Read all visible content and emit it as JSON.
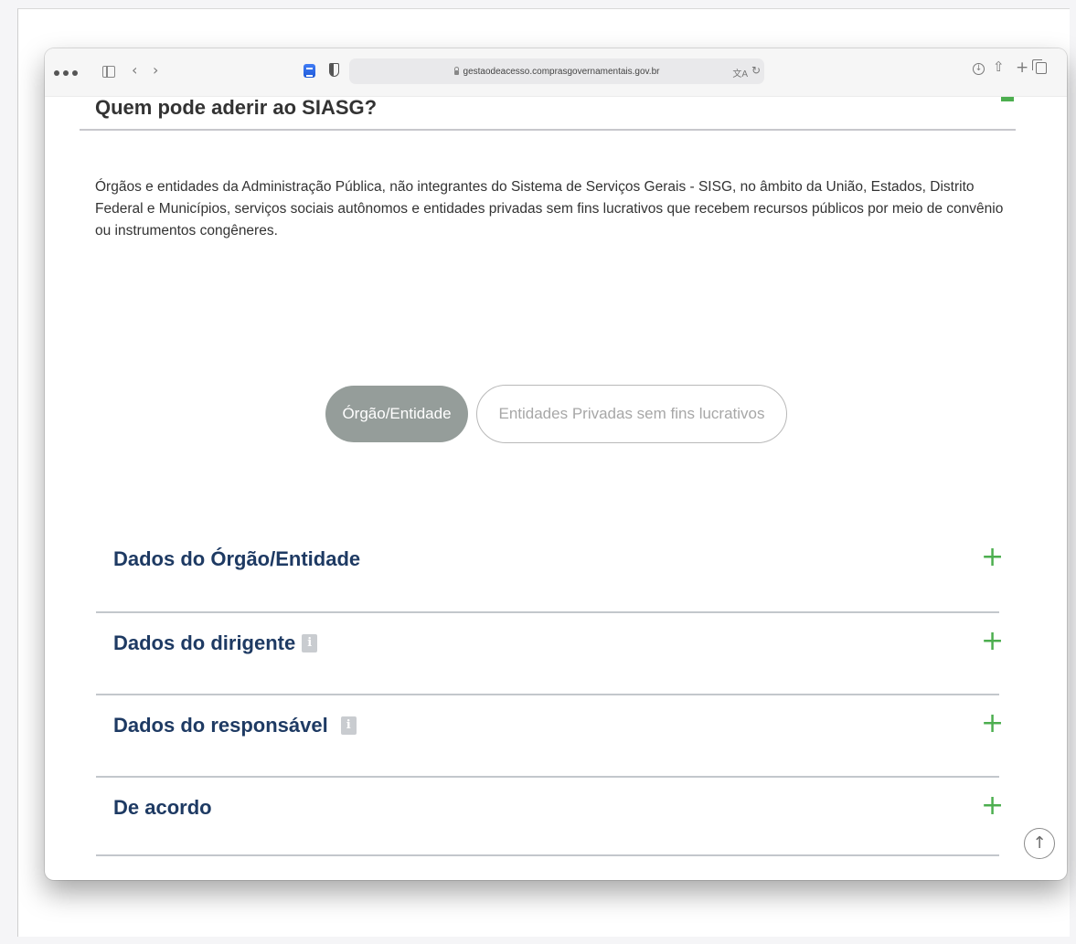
{
  "browser": {
    "url": "gestaodeacesso.comprasgovernamentais.gov.br",
    "icons": [
      "sidebar-icon",
      "back-icon",
      "forward-icon",
      "extension-icon",
      "privacy-shield-icon",
      "lock-icon",
      "translate-icon",
      "reload-icon",
      "download-icon",
      "share-icon",
      "new-tab-icon",
      "tabs-overview-icon"
    ]
  },
  "faq": {
    "title": "Quem pode aderir ao SIASG?",
    "body": "Órgãos e entidades da Administração Pública, não integrantes do Sistema de Serviços Gerais - SISG, no âmbito da União, Estados, Distrito Federal e Municípios, serviços sociais autônomos e entidades privadas sem fins lucrativos que recebem recursos públicos por meio de convênio ou instrumentos congêneres."
  },
  "toggle": {
    "options": [
      {
        "label": "Órgão/Entidade",
        "selected": true
      },
      {
        "label": "Entidades Privadas sem fins lucrativos",
        "selected": false
      }
    ]
  },
  "sections": [
    {
      "title": "Dados do Órgão/Entidade",
      "has_info": false
    },
    {
      "title": "Dados do dirigente",
      "has_info": true
    },
    {
      "title": "Dados do responsável",
      "has_info": true
    },
    {
      "title": "De acordo",
      "has_info": false
    }
  ],
  "glyphs": {
    "plus": "+",
    "info": "i",
    "back": "‹",
    "forward": "›",
    "share": "⇧",
    "new_tab": "+",
    "reload": "↻",
    "download": "↓",
    "translate": "文A",
    "back_to_top": "↑"
  },
  "colors": {
    "accent_green": "#4cae4f",
    "heading_navy": "#1e3a63",
    "toggle_active_bg": "#959d9a",
    "info_badge": "#c9ccd0"
  }
}
